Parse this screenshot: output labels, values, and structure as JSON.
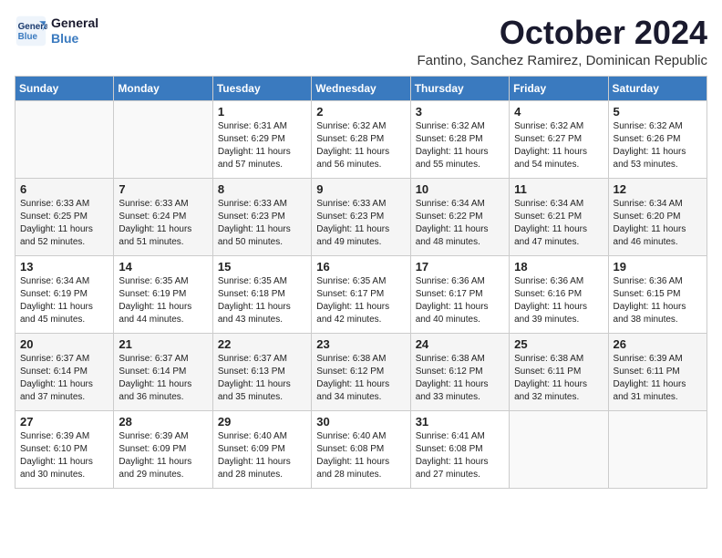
{
  "header": {
    "logo_line1": "General",
    "logo_line2": "Blue",
    "month": "October 2024",
    "location": "Fantino, Sanchez Ramirez, Dominican Republic"
  },
  "weekdays": [
    "Sunday",
    "Monday",
    "Tuesday",
    "Wednesday",
    "Thursday",
    "Friday",
    "Saturday"
  ],
  "weeks": [
    [
      {
        "day": "",
        "sunrise": "",
        "sunset": "",
        "daylight": ""
      },
      {
        "day": "",
        "sunrise": "",
        "sunset": "",
        "daylight": ""
      },
      {
        "day": "1",
        "sunrise": "Sunrise: 6:31 AM",
        "sunset": "Sunset: 6:29 PM",
        "daylight": "Daylight: 11 hours and 57 minutes."
      },
      {
        "day": "2",
        "sunrise": "Sunrise: 6:32 AM",
        "sunset": "Sunset: 6:28 PM",
        "daylight": "Daylight: 11 hours and 56 minutes."
      },
      {
        "day": "3",
        "sunrise": "Sunrise: 6:32 AM",
        "sunset": "Sunset: 6:28 PM",
        "daylight": "Daylight: 11 hours and 55 minutes."
      },
      {
        "day": "4",
        "sunrise": "Sunrise: 6:32 AM",
        "sunset": "Sunset: 6:27 PM",
        "daylight": "Daylight: 11 hours and 54 minutes."
      },
      {
        "day": "5",
        "sunrise": "Sunrise: 6:32 AM",
        "sunset": "Sunset: 6:26 PM",
        "daylight": "Daylight: 11 hours and 53 minutes."
      }
    ],
    [
      {
        "day": "6",
        "sunrise": "Sunrise: 6:33 AM",
        "sunset": "Sunset: 6:25 PM",
        "daylight": "Daylight: 11 hours and 52 minutes."
      },
      {
        "day": "7",
        "sunrise": "Sunrise: 6:33 AM",
        "sunset": "Sunset: 6:24 PM",
        "daylight": "Daylight: 11 hours and 51 minutes."
      },
      {
        "day": "8",
        "sunrise": "Sunrise: 6:33 AM",
        "sunset": "Sunset: 6:23 PM",
        "daylight": "Daylight: 11 hours and 50 minutes."
      },
      {
        "day": "9",
        "sunrise": "Sunrise: 6:33 AM",
        "sunset": "Sunset: 6:23 PM",
        "daylight": "Daylight: 11 hours and 49 minutes."
      },
      {
        "day": "10",
        "sunrise": "Sunrise: 6:34 AM",
        "sunset": "Sunset: 6:22 PM",
        "daylight": "Daylight: 11 hours and 48 minutes."
      },
      {
        "day": "11",
        "sunrise": "Sunrise: 6:34 AM",
        "sunset": "Sunset: 6:21 PM",
        "daylight": "Daylight: 11 hours and 47 minutes."
      },
      {
        "day": "12",
        "sunrise": "Sunrise: 6:34 AM",
        "sunset": "Sunset: 6:20 PM",
        "daylight": "Daylight: 11 hours and 46 minutes."
      }
    ],
    [
      {
        "day": "13",
        "sunrise": "Sunrise: 6:34 AM",
        "sunset": "Sunset: 6:19 PM",
        "daylight": "Daylight: 11 hours and 45 minutes."
      },
      {
        "day": "14",
        "sunrise": "Sunrise: 6:35 AM",
        "sunset": "Sunset: 6:19 PM",
        "daylight": "Daylight: 11 hours and 44 minutes."
      },
      {
        "day": "15",
        "sunrise": "Sunrise: 6:35 AM",
        "sunset": "Sunset: 6:18 PM",
        "daylight": "Daylight: 11 hours and 43 minutes."
      },
      {
        "day": "16",
        "sunrise": "Sunrise: 6:35 AM",
        "sunset": "Sunset: 6:17 PM",
        "daylight": "Daylight: 11 hours and 42 minutes."
      },
      {
        "day": "17",
        "sunrise": "Sunrise: 6:36 AM",
        "sunset": "Sunset: 6:17 PM",
        "daylight": "Daylight: 11 hours and 40 minutes."
      },
      {
        "day": "18",
        "sunrise": "Sunrise: 6:36 AM",
        "sunset": "Sunset: 6:16 PM",
        "daylight": "Daylight: 11 hours and 39 minutes."
      },
      {
        "day": "19",
        "sunrise": "Sunrise: 6:36 AM",
        "sunset": "Sunset: 6:15 PM",
        "daylight": "Daylight: 11 hours and 38 minutes."
      }
    ],
    [
      {
        "day": "20",
        "sunrise": "Sunrise: 6:37 AM",
        "sunset": "Sunset: 6:14 PM",
        "daylight": "Daylight: 11 hours and 37 minutes."
      },
      {
        "day": "21",
        "sunrise": "Sunrise: 6:37 AM",
        "sunset": "Sunset: 6:14 PM",
        "daylight": "Daylight: 11 hours and 36 minutes."
      },
      {
        "day": "22",
        "sunrise": "Sunrise: 6:37 AM",
        "sunset": "Sunset: 6:13 PM",
        "daylight": "Daylight: 11 hours and 35 minutes."
      },
      {
        "day": "23",
        "sunrise": "Sunrise: 6:38 AM",
        "sunset": "Sunset: 6:12 PM",
        "daylight": "Daylight: 11 hours and 34 minutes."
      },
      {
        "day": "24",
        "sunrise": "Sunrise: 6:38 AM",
        "sunset": "Sunset: 6:12 PM",
        "daylight": "Daylight: 11 hours and 33 minutes."
      },
      {
        "day": "25",
        "sunrise": "Sunrise: 6:38 AM",
        "sunset": "Sunset: 6:11 PM",
        "daylight": "Daylight: 11 hours and 32 minutes."
      },
      {
        "day": "26",
        "sunrise": "Sunrise: 6:39 AM",
        "sunset": "Sunset: 6:11 PM",
        "daylight": "Daylight: 11 hours and 31 minutes."
      }
    ],
    [
      {
        "day": "27",
        "sunrise": "Sunrise: 6:39 AM",
        "sunset": "Sunset: 6:10 PM",
        "daylight": "Daylight: 11 hours and 30 minutes."
      },
      {
        "day": "28",
        "sunrise": "Sunrise: 6:39 AM",
        "sunset": "Sunset: 6:09 PM",
        "daylight": "Daylight: 11 hours and 29 minutes."
      },
      {
        "day": "29",
        "sunrise": "Sunrise: 6:40 AM",
        "sunset": "Sunset: 6:09 PM",
        "daylight": "Daylight: 11 hours and 28 minutes."
      },
      {
        "day": "30",
        "sunrise": "Sunrise: 6:40 AM",
        "sunset": "Sunset: 6:08 PM",
        "daylight": "Daylight: 11 hours and 28 minutes."
      },
      {
        "day": "31",
        "sunrise": "Sunrise: 6:41 AM",
        "sunset": "Sunset: 6:08 PM",
        "daylight": "Daylight: 11 hours and 27 minutes."
      },
      {
        "day": "",
        "sunrise": "",
        "sunset": "",
        "daylight": ""
      },
      {
        "day": "",
        "sunrise": "",
        "sunset": "",
        "daylight": ""
      }
    ]
  ]
}
